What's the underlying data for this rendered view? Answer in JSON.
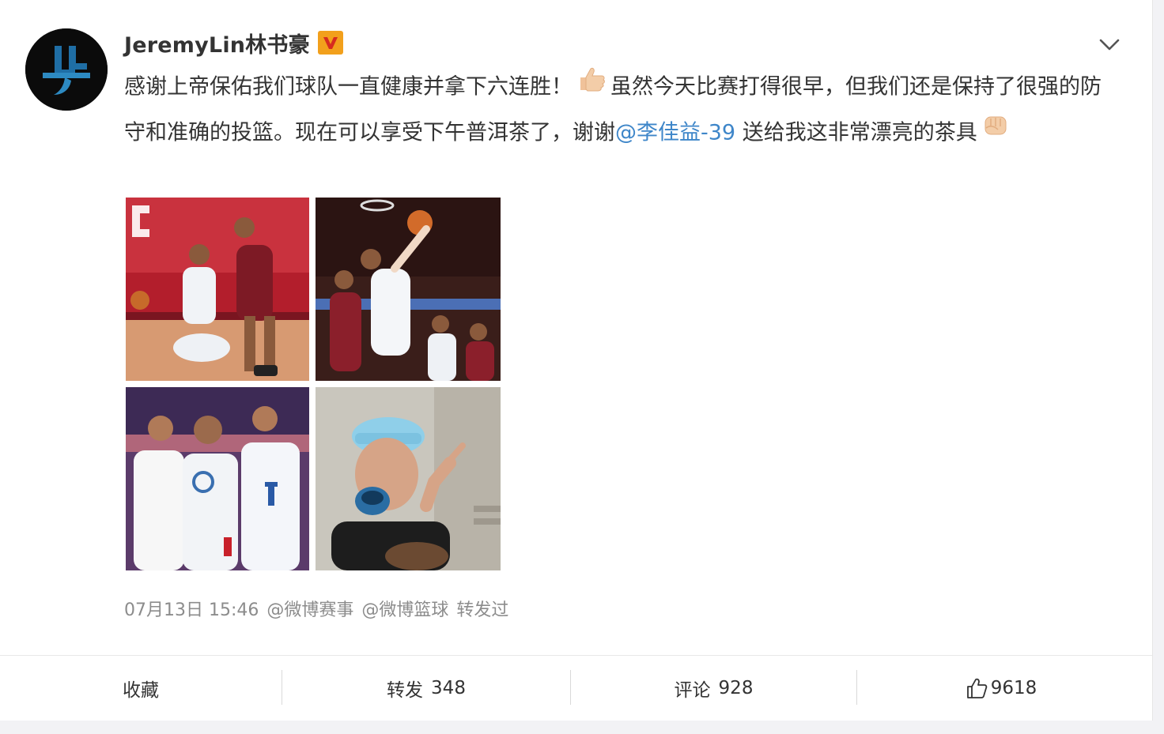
{
  "post": {
    "username": "JeremyLin林书豪",
    "text_part1": "感谢上帝保佑我们球队一直健康并拿下六连胜！",
    "text_part2": "虽然今天比赛打得很早，但我们还是保持了很强的防守和准确的投篮。现在可以享受下午普洱茶了，谢谢",
    "mention": "@李佳益-39",
    "text_part3": " 送给我这非常漂亮的茶具",
    "emoji_1": "thumbs-up-icon",
    "emoji_2": "fist-bump-icon"
  },
  "meta": {
    "time": "07月13日 15:46",
    "source_1": "@微博赛事",
    "source_2": "@微博篮球",
    "suffix": "转发过"
  },
  "actions": {
    "favorite_label": "收藏",
    "forward_label": "转发",
    "forward_count": "348",
    "comment_label": "评论",
    "comment_count": "928",
    "like_count": "9618"
  },
  "colors": {
    "link": "#3e86c9",
    "verified": "#f2a01c",
    "meta": "#8c8c8c",
    "text": "#333333"
  },
  "icons": {
    "verified": "verified-v-icon",
    "menu": "chevron-down-icon",
    "like": "thumb-up-outline-icon"
  }
}
